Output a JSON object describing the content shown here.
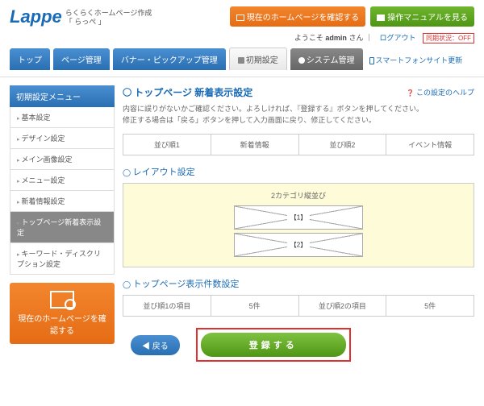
{
  "brand": {
    "logo": "Lappe",
    "tagline1": "らくらくホームページ作成",
    "tagline2": "「 らっぺ 」"
  },
  "header": {
    "check_hp": "現在のホームページを確認する",
    "manual": "操作マニュアルを見る"
  },
  "userbar": {
    "welcome": "ようこそ",
    "user": "admin",
    "suffix": "さん",
    "logout": "ログアウト",
    "sync": "同期状況：OFF"
  },
  "tabs": {
    "top": "トップ",
    "page": "ページ管理",
    "banner": "バナー・ピックアップ管理",
    "initial": "初期設定",
    "system": "システム管理",
    "sp": "スマートフォンサイト更新"
  },
  "sidebar": {
    "head": "初期設定メニュー",
    "items": [
      "基本設定",
      "デザイン設定",
      "メイン画像設定",
      "メニュー設定",
      "新着情報設定",
      "トップページ新着表示設定",
      "キーワード・ディスクリプション設定"
    ],
    "cta": "現在のホームページを確認する"
  },
  "page": {
    "title": "トップページ 新着表示設定",
    "help": "この設定のヘルプ",
    "desc1": "内容に誤りがないかご確認ください。よろしければ、『登録する』ボタンを押してください。",
    "desc2": "修正する場合は「戻る」ボタンを押して入力画面に戻り、修正してください。"
  },
  "order_tabs": [
    "並び順1",
    "新着情報",
    "並び順2",
    "イベント情報"
  ],
  "layout": {
    "title": "レイアウト設定",
    "label": "2カテゴリ縦並び",
    "ph1": "【1】",
    "ph2": "【2】"
  },
  "count": {
    "title": "トップページ表示件数設定",
    "cells": [
      "並び順1の項目",
      "5件",
      "並び順2の項目",
      "5件"
    ]
  },
  "actions": {
    "back": "戻る",
    "submit": "登録する"
  }
}
